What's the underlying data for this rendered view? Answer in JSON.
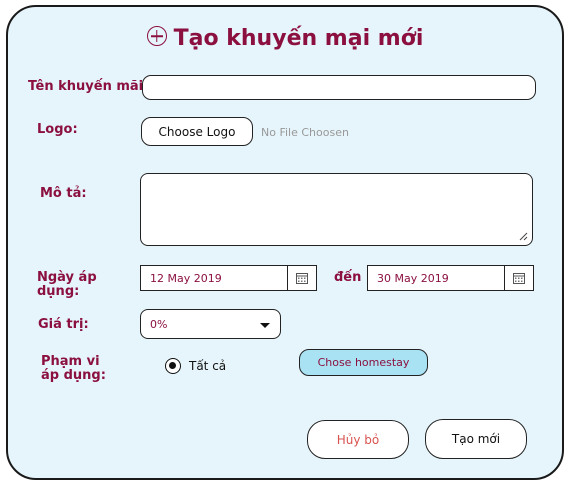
{
  "title": "Tạo khuyến mại mới",
  "form": {
    "name_label": "Tên khuyến mãi:",
    "name_value": "",
    "logo_label": "Logo:",
    "logo_button": "Choose Logo",
    "logo_hint": "No File Choosen",
    "desc_label": "Mô tả:",
    "desc_value": "",
    "date_label": "Ngày áp dụng:",
    "date_from": "12 May 2019",
    "date_to_label": "đến",
    "date_to": "30 May 2019",
    "value_label": "Giá trị:",
    "value_selected": "0%",
    "scope_label": "Phạm vi áp dụng:",
    "scope_option": "Tất cả",
    "scope_option_selected": true,
    "homestay_button": "Chose homestay"
  },
  "actions": {
    "cancel": "Hủy bỏ",
    "create": "Tạo mới"
  },
  "colors": {
    "accent": "#8b1040",
    "modal_bg": "#e6f5fb",
    "homestay_button_bg": "#a9e2f3",
    "cancel_text": "#d9534f"
  },
  "icons": {
    "title": "plus-circle-icon",
    "date": "calendar-icon",
    "select": "chevron-down-icon"
  }
}
